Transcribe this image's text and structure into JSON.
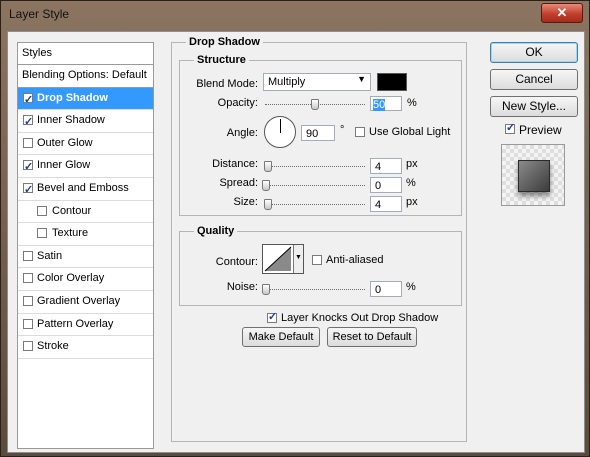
{
  "window": {
    "title": "Layer Style",
    "close": "✕"
  },
  "styles": {
    "header": "Styles",
    "items": [
      {
        "label": "Blending Options: Default"
      },
      {
        "label": "Drop Shadow",
        "checked": true,
        "selected": true
      },
      {
        "label": "Inner Shadow",
        "checked": true
      },
      {
        "label": "Outer Glow",
        "checked": false
      },
      {
        "label": "Inner Glow",
        "checked": true
      },
      {
        "label": "Bevel and Emboss",
        "checked": true
      },
      {
        "label": "Contour",
        "checked": false,
        "indent": true
      },
      {
        "label": "Texture",
        "checked": false,
        "indent": true
      },
      {
        "label": "Satin",
        "checked": false
      },
      {
        "label": "Color Overlay",
        "checked": false
      },
      {
        "label": "Gradient Overlay",
        "checked": false
      },
      {
        "label": "Pattern Overlay",
        "checked": false
      },
      {
        "label": "Stroke",
        "checked": false
      }
    ]
  },
  "drop_shadow": {
    "title": "Drop Shadow",
    "structure": {
      "title": "Structure",
      "blend_mode_label": "Blend Mode:",
      "blend_mode": "Multiply",
      "shadow_color": "#000000",
      "opacity_label": "Opacity:",
      "opacity": "50",
      "opacity_unit": "%",
      "opacity_fraction": 0.5,
      "angle_label": "Angle:",
      "angle": "90",
      "angle_unit": "°",
      "use_global_light": "Use Global Light",
      "distance_label": "Distance:",
      "distance": "4",
      "distance_unit": "px",
      "spread_label": "Spread:",
      "spread": "0",
      "spread_unit": "%",
      "size_label": "Size:",
      "size": "4",
      "size_unit": "px"
    },
    "quality": {
      "title": "Quality",
      "contour_label": "Contour:",
      "anti_aliased": "Anti-aliased",
      "noise_label": "Noise:",
      "noise": "0",
      "noise_unit": "%"
    },
    "layer_knocks_out": "Layer Knocks Out Drop Shadow",
    "make_default": "Make Default",
    "reset_to_default": "Reset to Default"
  },
  "buttons": {
    "ok": "OK",
    "cancel": "Cancel",
    "new_style": "New Style...",
    "preview": "Preview"
  },
  "colors": {
    "selection": "#3399ff",
    "dialog_bg": "#f0f0f0"
  }
}
